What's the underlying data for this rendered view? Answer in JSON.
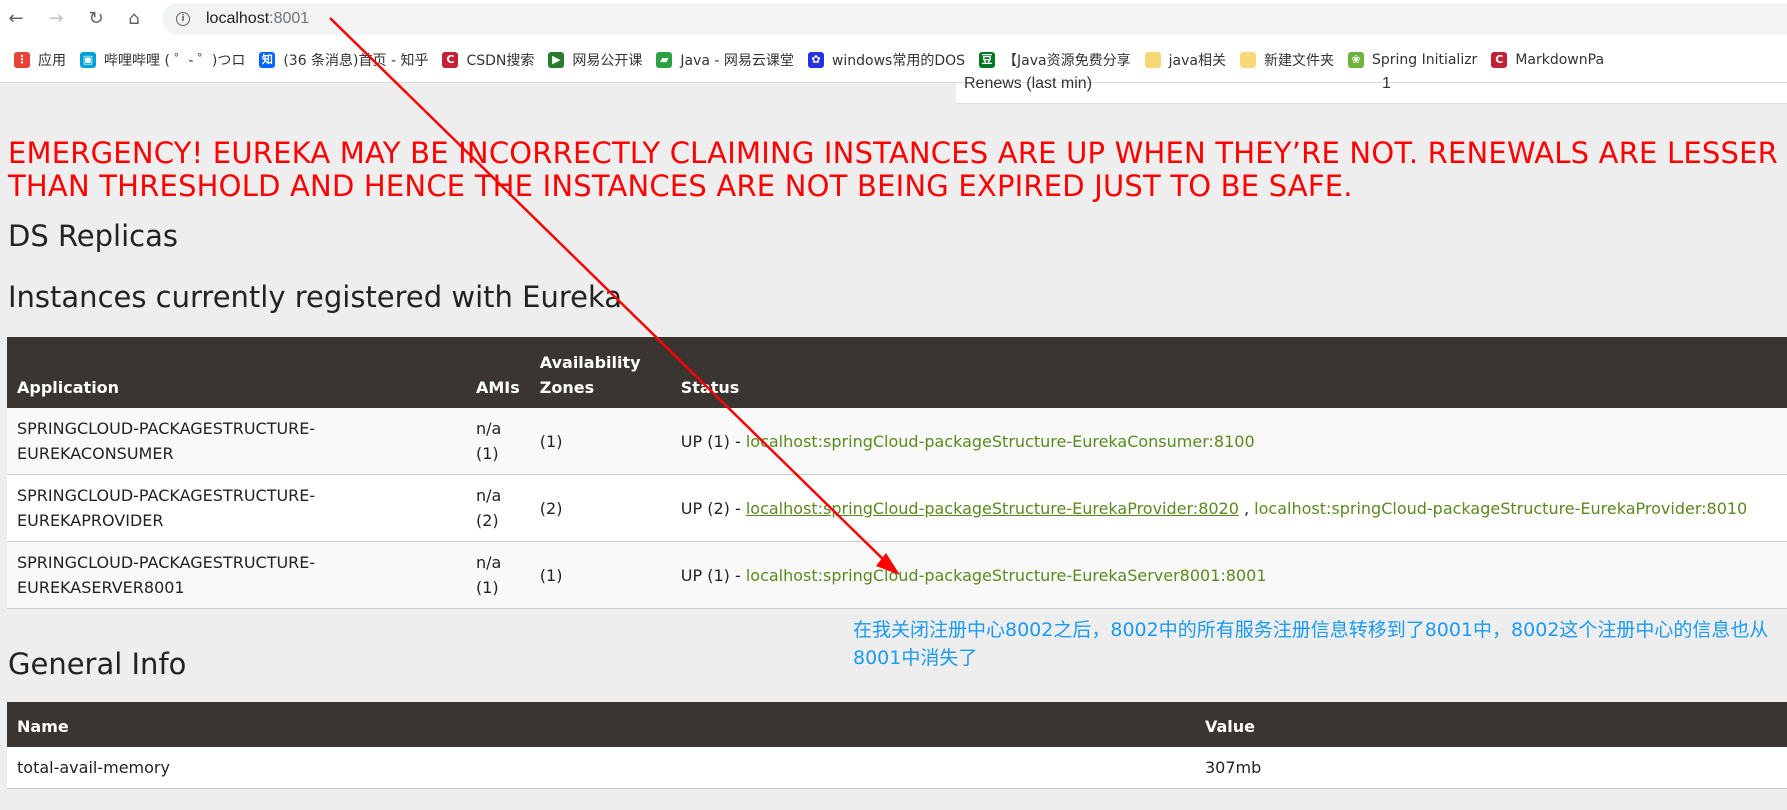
{
  "browser": {
    "url_host": "localhost",
    "url_port": ":8001",
    "bookmarks": [
      {
        "label": "应用",
        "icon": "apps-grid-icon",
        "color": "#ea4335"
      },
      {
        "label": "哔哩哔哩 ( ゜- ゜)つロ",
        "icon": "bilibili-icon",
        "color": "#00a1d6"
      },
      {
        "label": "(36 条消息)首页 - 知乎",
        "icon": "zhihu-icon",
        "color": "#0066ff"
      },
      {
        "label": "CSDN搜索",
        "icon": "csdn-icon",
        "color": "#c32136"
      },
      {
        "label": "网易公开课",
        "icon": "netease-open-icon",
        "color": "#2a7d2e"
      },
      {
        "label": "Java - 网易云课堂",
        "icon": "netease-cloud-class-icon",
        "color": "#2ea043"
      },
      {
        "label": "windows常用的DOS",
        "icon": "baidu-paw-icon",
        "color": "#2932e1"
      },
      {
        "label": "【Java资源免费分享",
        "icon": "douban-icon",
        "color": "#007722"
      },
      {
        "label": "java相关",
        "icon": "folder-icon",
        "color": "#f8d775"
      },
      {
        "label": "新建文件夹",
        "icon": "folder-icon",
        "color": "#f8d775"
      },
      {
        "label": "Spring Initializr",
        "icon": "spring-icon",
        "color": "#6db33f"
      },
      {
        "label": "MarkdownPa",
        "icon": "csdn-icon",
        "color": "#c32136"
      }
    ]
  },
  "renews": {
    "label": "Renews (last min)",
    "value": "1"
  },
  "emergency_lines": [
    "EMERGENCY! EUREKA MAY BE INCORRECTLY CLAIMING INSTANCES ARE UP WHEN THEY’RE NOT. RENEWALS ARE LESSER",
    "THAN THRESHOLD AND HENCE THE INSTANCES ARE NOT BEING EXPIRED JUST TO BE SAFE."
  ],
  "headings": {
    "ds_replicas": "DS Replicas",
    "instances": "Instances currently registered with Eureka",
    "general_info": "General Info"
  },
  "instances_table": {
    "headers": [
      "Application",
      "AMIs",
      "Availability Zones",
      "Status"
    ],
    "rows": [
      {
        "app": "SPRINGCLOUD-PACKAGESTRUCTURE-EUREKACONSUMER",
        "amis": "n/a (1)",
        "zones": "(1)",
        "status_prefix": "UP (1) - ",
        "links": [
          "localhost:springCloud-packageStructure-EurekaConsumer:8100"
        ]
      },
      {
        "app": "SPRINGCLOUD-PACKAGESTRUCTURE-EUREKAPROVIDER",
        "amis": "n/a (2)",
        "zones": "(2)",
        "status_prefix": "UP (2) - ",
        "links": [
          "localhost:springCloud-packageStructure-EurekaProvider:8020",
          "localhost:springCloud-packageStructure-EurekaProvider:8010"
        ]
      },
      {
        "app": "SPRINGCLOUD-PACKAGESTRUCTURE-EUREKASERVER8001",
        "amis": "n/a (1)",
        "zones": "(1)",
        "status_prefix": "UP (1) - ",
        "links": [
          "localhost:springCloud-packageStructure-EurekaServer8001:8001"
        ]
      }
    ]
  },
  "general_table": {
    "headers": [
      "Name",
      "Value"
    ],
    "rows": [
      {
        "name": "total-avail-memory",
        "value": "307mb"
      }
    ]
  },
  "annotation_note": "在我关闭注册中心8002之后，8002中的所有服务注册信息转移到了8001中，8002这个注册中心的信息也从8001中消失了",
  "colors": {
    "emergency": "#ff0000",
    "header_bg": "#3a3530",
    "link": "#5a8a1e",
    "note": "#1a9af0",
    "arrow": "#ff0000"
  }
}
